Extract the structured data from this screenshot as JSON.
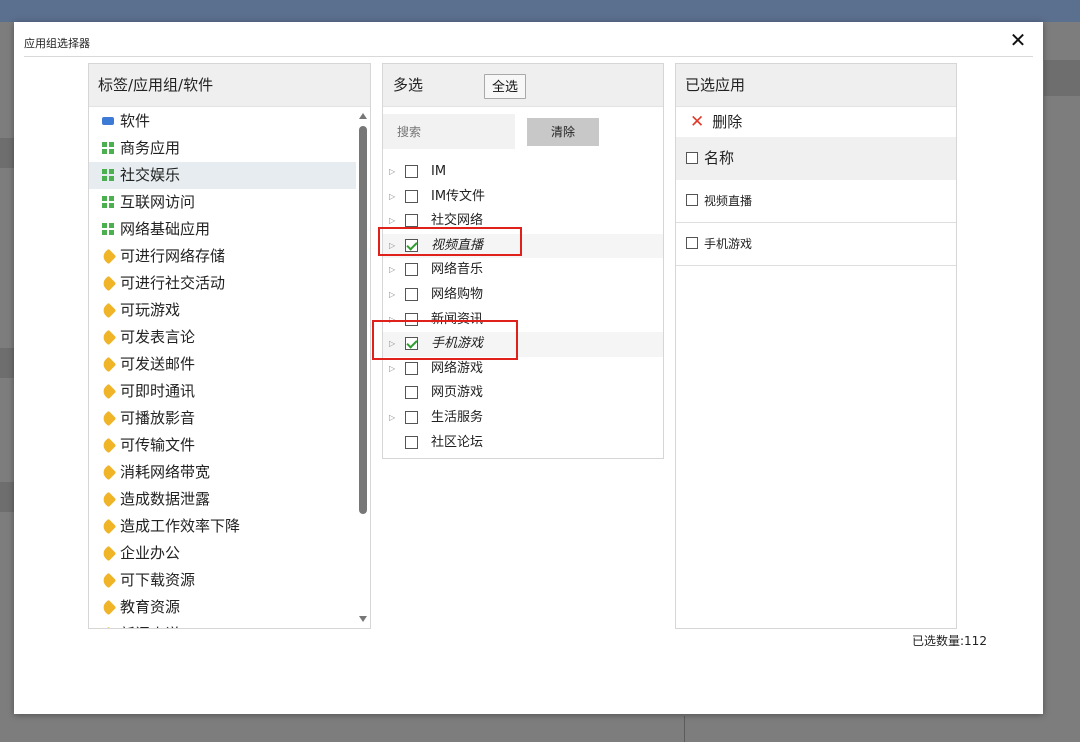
{
  "dialog": {
    "title": "应用组选择器",
    "close_icon": "close-icon"
  },
  "left_panel": {
    "header": "标签/应用组/软件",
    "items": [
      {
        "label": "软件",
        "icon": "software-icon"
      },
      {
        "label": "商务应用",
        "icon": "app-group-icon"
      },
      {
        "label": "社交娱乐",
        "icon": "app-group-icon",
        "active": true
      },
      {
        "label": "互联网访问",
        "icon": "app-group-icon"
      },
      {
        "label": "网络基础应用",
        "icon": "app-group-icon"
      },
      {
        "label": "可进行网络存储",
        "icon": "tag-icon"
      },
      {
        "label": "可进行社交活动",
        "icon": "tag-icon"
      },
      {
        "label": "可玩游戏",
        "icon": "tag-icon"
      },
      {
        "label": "可发表言论",
        "icon": "tag-icon"
      },
      {
        "label": "可发送邮件",
        "icon": "tag-icon"
      },
      {
        "label": "可即时通讯",
        "icon": "tag-icon"
      },
      {
        "label": "可播放影音",
        "icon": "tag-icon"
      },
      {
        "label": "可传输文件",
        "icon": "tag-icon"
      },
      {
        "label": "消耗网络带宽",
        "icon": "tag-icon"
      },
      {
        "label": "造成数据泄露",
        "icon": "tag-icon"
      },
      {
        "label": "造成工作效率下降",
        "icon": "tag-icon"
      },
      {
        "label": "企业办公",
        "icon": "tag-icon"
      },
      {
        "label": "可下载资源",
        "icon": "tag-icon"
      },
      {
        "label": "教育资源",
        "icon": "tag-icon"
      },
      {
        "label": "新闻小说",
        "icon": "tag-icon"
      }
    ]
  },
  "middle_panel": {
    "header": "多选",
    "select_all_label": "全选",
    "search_placeholder": "搜索",
    "clear_label": "清除",
    "items": [
      {
        "label": "IM",
        "expandable": true,
        "checked": false
      },
      {
        "label": "IM传文件",
        "expandable": true,
        "checked": false
      },
      {
        "label": "社交网络",
        "expandable": true,
        "checked": false
      },
      {
        "label": "视频直播",
        "expandable": true,
        "checked": true
      },
      {
        "label": "网络音乐",
        "expandable": true,
        "checked": false
      },
      {
        "label": "网络购物",
        "expandable": true,
        "checked": false
      },
      {
        "label": "新闻资讯",
        "expandable": true,
        "checked": false
      },
      {
        "label": "手机游戏",
        "expandable": true,
        "checked": true
      },
      {
        "label": "网络游戏",
        "expandable": true,
        "checked": false
      },
      {
        "label": "网页游戏",
        "expandable": false,
        "checked": false
      },
      {
        "label": "生活服务",
        "expandable": true,
        "checked": false
      },
      {
        "label": "社区论坛",
        "expandable": false,
        "checked": false
      }
    ]
  },
  "right_panel": {
    "header": "已选应用",
    "delete_label": "删除",
    "name_column": "名称",
    "selected": [
      "视频直播",
      "手机游戏"
    ]
  },
  "footer": {
    "count_label": "已选数量:112"
  },
  "colors": {
    "highlight_border": "#e0201a",
    "delete_icon": "#e03b2a",
    "tag_icon": "#f0b429",
    "group_icon": "#4caf50",
    "software_icon": "#3d7ad6"
  }
}
